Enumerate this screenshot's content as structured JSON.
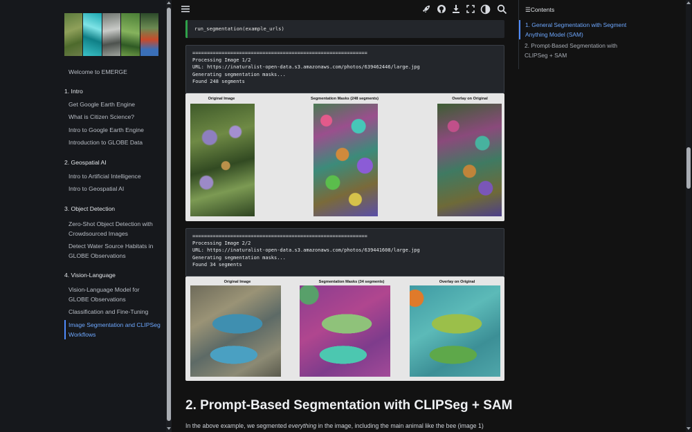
{
  "sidebar": {
    "nav": [
      {
        "label": "Welcome to EMERGE",
        "kind": "item"
      },
      {
        "label": "1. Intro",
        "kind": "section"
      },
      {
        "label": "Get Google Earth Engine",
        "kind": "item"
      },
      {
        "label": "What is Citizen Science?",
        "kind": "item"
      },
      {
        "label": "Intro to Google Earth Engine",
        "kind": "item"
      },
      {
        "label": "Introduction to GLOBE Data",
        "kind": "item"
      },
      {
        "label": "2. Geospatial AI",
        "kind": "section"
      },
      {
        "label": "Intro to Artificial Intelligence",
        "kind": "item"
      },
      {
        "label": "Intro to Geospatial AI",
        "kind": "item"
      },
      {
        "label": "3. Object Detection",
        "kind": "section"
      },
      {
        "label": "Zero-Shot Object Detection with Crowdsourced Images",
        "kind": "item"
      },
      {
        "label": "Detect Water Source Habitats in GLOBE Observations",
        "kind": "item"
      },
      {
        "label": "4. Vision-Language",
        "kind": "section"
      },
      {
        "label": "Vision-Language Model for GLOBE Observations",
        "kind": "item"
      },
      {
        "label": "Classification and Fine-Tuning",
        "kind": "item"
      },
      {
        "label": "Image Segmentation and CLIPSeg Workflows",
        "kind": "active"
      }
    ]
  },
  "topbar": {
    "icons": [
      "menu-icon",
      "rocket-icon",
      "github-icon",
      "download-icon",
      "fullscreen-icon",
      "theme-icon",
      "search-icon"
    ]
  },
  "cell": {
    "code": "run_segmentation(example_urls)"
  },
  "outputs": [
    {
      "text": "============================================================\nProcessing Image 1/2\nURL: https://inaturalist-open-data.s3.amazonaws.com/photos/639462446/large.jpg\nGenerating segmentation masks...\nFound 248 segments",
      "titles": [
        "Original Image",
        "Segmentation Masks (248 segments)",
        "Overlay on Original"
      ]
    },
    {
      "text": "============================================================\nProcessing Image 2/2\nURL: https://inaturalist-open-data.s3.amazonaws.com/photos/639441608/large.jpg\nGenerating segmentation masks...\nFound 34 segments",
      "titles": [
        "Original Image",
        "Segmentation Masks (34 segments)",
        "Overlay on Original"
      ]
    }
  ],
  "content": {
    "heading": "2. Prompt-Based Segmentation with CLIPSeg + SAM",
    "para_before": "In the above example, we segmented ",
    "para_em": "everything",
    "para_after": " in the image, including the main animal like the bee (image 1)"
  },
  "toc": {
    "title": "Contents",
    "items": [
      {
        "label": "1. General Segmentation with Segment Anything Model (SAM)",
        "active": true
      },
      {
        "label": "2. Prompt-Based Segmentation with CLIPSeg + SAM",
        "active": false
      }
    ]
  },
  "colors": {
    "accent": "#4f8cff",
    "code_border": "#2fa24a",
    "background": "#121212"
  }
}
